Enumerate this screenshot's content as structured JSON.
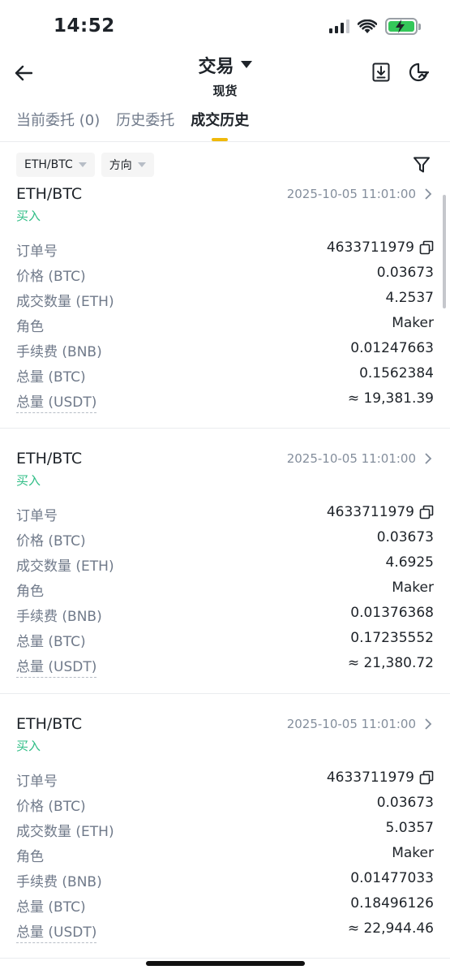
{
  "status": {
    "time": "14:52",
    "icons": [
      "cellular-signal-icon",
      "wifi-icon",
      "battery-charging-icon"
    ]
  },
  "nav": {
    "title": "交易",
    "subtitle": "现货",
    "back_icon": "arrow-left-icon",
    "actions": [
      "download-icon",
      "pie-chart-icon"
    ]
  },
  "tabs": [
    {
      "label": "当前委托 (0)",
      "active": false
    },
    {
      "label": "历史委托",
      "active": false
    },
    {
      "label": "成交历史",
      "active": true
    }
  ],
  "filters": {
    "pair": "ETH/BTC",
    "direction": "方向",
    "filter_icon": "filter-icon"
  },
  "labels": {
    "order_no": "订单号",
    "price": "价格 (BTC)",
    "filled_qty": "成交数量 (ETH)",
    "role": "角色",
    "fee": "手续费 (BNB)",
    "total_btc": "总量 (BTC)",
    "total_usdt": "总量 (USDT)"
  },
  "records": [
    {
      "pair": "ETH/BTC",
      "time": "2025-10-05 11:01:00",
      "side": "买入",
      "order_no": "4633711979",
      "price": "0.03673",
      "filled_qty": "4.2537",
      "role": "Maker",
      "fee": "0.01247663",
      "total_btc": "0.1562384",
      "total_usdt": "≈ 19,381.39"
    },
    {
      "pair": "ETH/BTC",
      "time": "2025-10-05 11:01:00",
      "side": "买入",
      "order_no": "4633711979",
      "price": "0.03673",
      "filled_qty": "4.6925",
      "role": "Maker",
      "fee": "0.01376368",
      "total_btc": "0.17235552",
      "total_usdt": "≈ 21,380.72"
    },
    {
      "pair": "ETH/BTC",
      "time": "2025-10-05 11:01:00",
      "side": "买入",
      "order_no": "4633711979",
      "price": "0.03673",
      "filled_qty": "5.0357",
      "role": "Maker",
      "fee": "0.01477033",
      "total_btc": "0.18496126",
      "total_usdt": "≈ 22,944.46"
    }
  ],
  "colors": {
    "accent": "#f0b90b",
    "buy": "#2ebd85",
    "text_primary": "#1e2329",
    "text_secondary": "#707a8a"
  }
}
